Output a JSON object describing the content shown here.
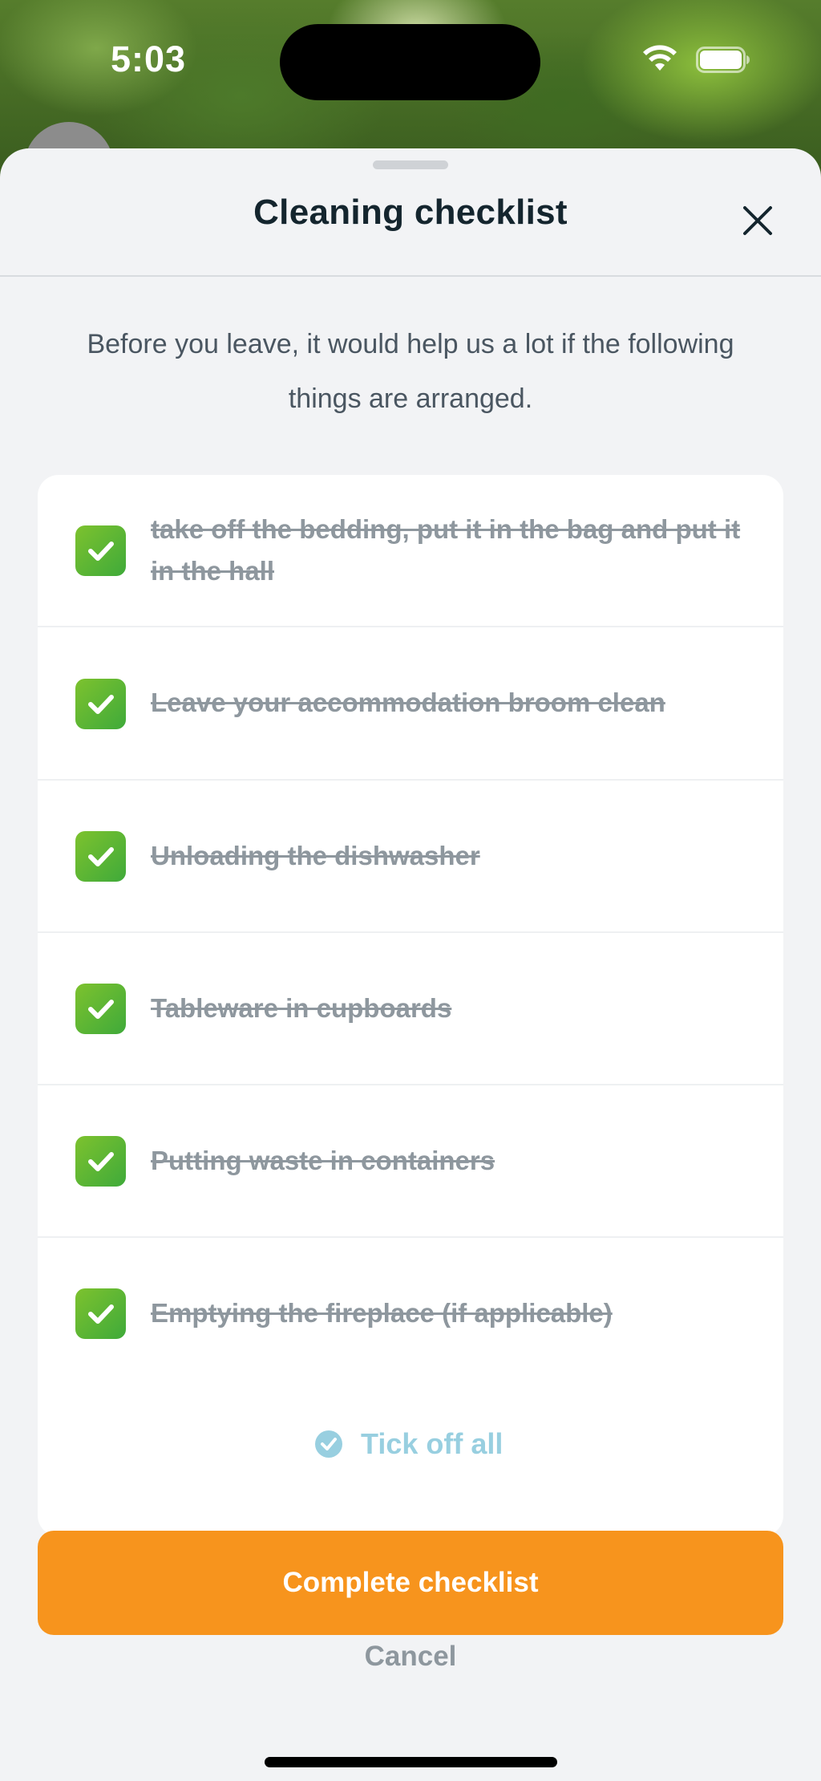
{
  "status_bar": {
    "time": "5:03",
    "wifi_icon": "wifi-icon",
    "battery_icon": "battery-full-icon"
  },
  "sheet": {
    "title": "Cleaning checklist",
    "close_icon": "close-icon",
    "intro": "Before you leave, it would help us a lot if the following things are arranged."
  },
  "checklist": {
    "items": [
      {
        "label": "take off the bedding, put it in the bag and put it in the hall",
        "checked": true
      },
      {
        "label": "Leave your accommodation broom clean",
        "checked": true
      },
      {
        "label": "Unloading the dishwasher",
        "checked": true
      },
      {
        "label": "Tableware in cupboards",
        "checked": true
      },
      {
        "label": "Putting waste in containers",
        "checked": true
      },
      {
        "label": "Emptying the fireplace (if applicable)",
        "checked": true
      }
    ],
    "tick_all_label": "Tick off all"
  },
  "actions": {
    "complete_label": "Complete checklist",
    "cancel_label": "Cancel"
  },
  "colors": {
    "accent_orange": "#f7941d",
    "check_green": "#5cb53a",
    "tick_all_blue": "#98cfe0",
    "title_dark": "#14252e"
  }
}
